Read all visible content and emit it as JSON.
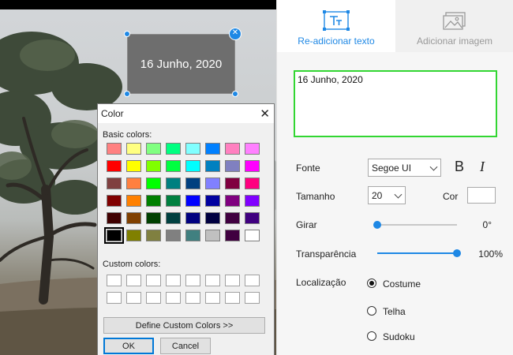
{
  "canvas": {
    "text_box": "16 Junho, 2020"
  },
  "color_dialog": {
    "title": "Color",
    "basic_colors_label": "Basic colors:",
    "custom_colors_label": "Custom colors:",
    "define_button": "Define Custom Colors >>",
    "ok_button": "OK",
    "cancel_button": "Cancel",
    "basic_colors": [
      [
        "#ff8080",
        "#ffff80",
        "#80ff80",
        "#00ff80",
        "#80ffff",
        "#0080ff",
        "#ff80c0",
        "#ff80ff"
      ],
      [
        "#ff0000",
        "#ffff00",
        "#80ff00",
        "#00ff40",
        "#00ffff",
        "#0080c0",
        "#8080c0",
        "#ff00ff"
      ],
      [
        "#804040",
        "#ff8040",
        "#00ff00",
        "#008080",
        "#004080",
        "#8080ff",
        "#800040",
        "#ff0080"
      ],
      [
        "#800000",
        "#ff8000",
        "#008000",
        "#008040",
        "#0000ff",
        "#0000a0",
        "#800080",
        "#8000ff"
      ],
      [
        "#400000",
        "#804000",
        "#004000",
        "#004040",
        "#000080",
        "#000040",
        "#400040",
        "#400080"
      ],
      [
        "#000000",
        "#808000",
        "#808040",
        "#808080",
        "#408080",
        "#c0c0c0",
        "#400040",
        "#ffffff"
      ]
    ],
    "selected_color": "#000000"
  },
  "panel": {
    "tabs": [
      {
        "label": "Re-adicionar texto",
        "icon": "text-icon",
        "active": true
      },
      {
        "label": "Adicionar imagem",
        "icon": "image-icon",
        "active": false
      }
    ],
    "text_value": "16 Junho, 2020",
    "font_label": "Fonte",
    "font_value": "Segoe UI",
    "bold_label": "B",
    "italic_label": "I",
    "size_label": "Tamanho",
    "size_value": "20",
    "color_label": "Cor",
    "color_value": "#ffffff",
    "rotate_label": "Girar",
    "rotate_value": "0°",
    "rotate_fraction": 0,
    "transparency_label": "Transparência",
    "transparency_value": "100%",
    "transparency_fraction": 1.0,
    "location_label": "Localização",
    "location_options": [
      {
        "label": "Costume",
        "selected": true
      },
      {
        "label": "Telha",
        "selected": false
      },
      {
        "label": "Sudoku",
        "selected": false
      }
    ]
  },
  "colors": {
    "accent": "#1e88e5",
    "textarea_border": "#32d632"
  }
}
